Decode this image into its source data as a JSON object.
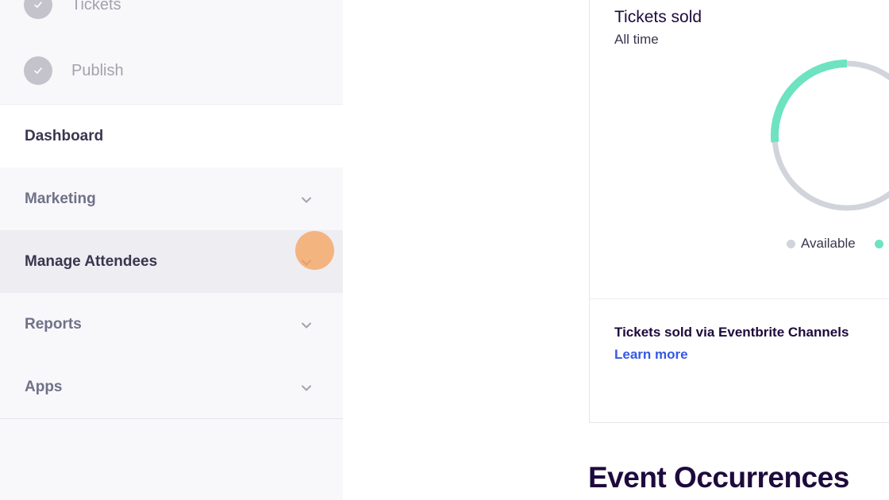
{
  "sidebar": {
    "steps": [
      {
        "label": "Tickets",
        "icon": "check-icon"
      },
      {
        "label": "Publish",
        "icon": "check-icon"
      }
    ],
    "nav": [
      {
        "label": "Dashboard",
        "state": "active"
      },
      {
        "label": "Marketing",
        "icon": "chevron-down-icon"
      },
      {
        "label": "Manage Attendees",
        "icon": "chevron-down-icon",
        "state": "hovered"
      },
      {
        "label": "Reports",
        "icon": "chevron-down-icon"
      },
      {
        "label": "Apps",
        "icon": "chevron-down-icon"
      }
    ]
  },
  "tickets_card": {
    "title": "Tickets sold",
    "subtitle": "All time",
    "legend": {
      "available": "Available"
    },
    "channels_title": "Tickets sold via Eventbrite Channels",
    "learn_more": "Learn more"
  },
  "section": {
    "heading": "Event Occurrences"
  },
  "colors": {
    "accent_teal": "#6de3c1",
    "ring_gray": "#d1d4db",
    "link_blue": "#3659e3",
    "heading_dark": "#1e0a3c"
  }
}
